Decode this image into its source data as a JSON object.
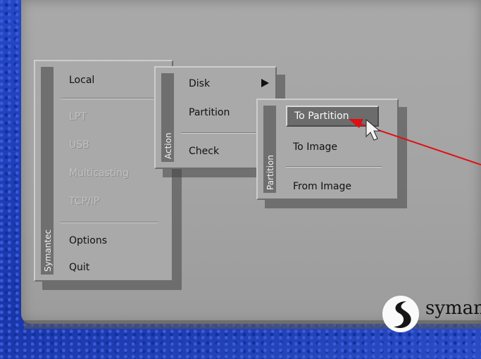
{
  "brand": {
    "name": "syman"
  },
  "main_menu": {
    "strip_label": "Symantec",
    "items": [
      {
        "label": "Local",
        "enabled": true
      },
      {
        "label": "LPT",
        "enabled": false
      },
      {
        "label": "USB",
        "enabled": false
      },
      {
        "label": "Multicasting",
        "enabled": false
      },
      {
        "label": "TCP/IP",
        "enabled": false
      },
      {
        "label": "Options",
        "enabled": true
      },
      {
        "label": "Quit",
        "enabled": true
      }
    ]
  },
  "action_menu": {
    "strip_label": "Action",
    "items": [
      {
        "label": "Disk",
        "has_submenu": true
      },
      {
        "label": "Partition",
        "has_submenu": false
      },
      {
        "label": "Check",
        "has_submenu": false
      }
    ]
  },
  "partition_menu": {
    "strip_label": "Partition",
    "items": [
      {
        "label": "To Partition",
        "selected": true
      },
      {
        "label": "To Image",
        "selected": false
      },
      {
        "label": "From Image",
        "selected": false
      }
    ]
  },
  "colors": {
    "annotation_arrow": "#e01010",
    "menu_face": "#a9a9a9",
    "menu_strip": "#6f6f6f",
    "background": "#1e40b8"
  }
}
